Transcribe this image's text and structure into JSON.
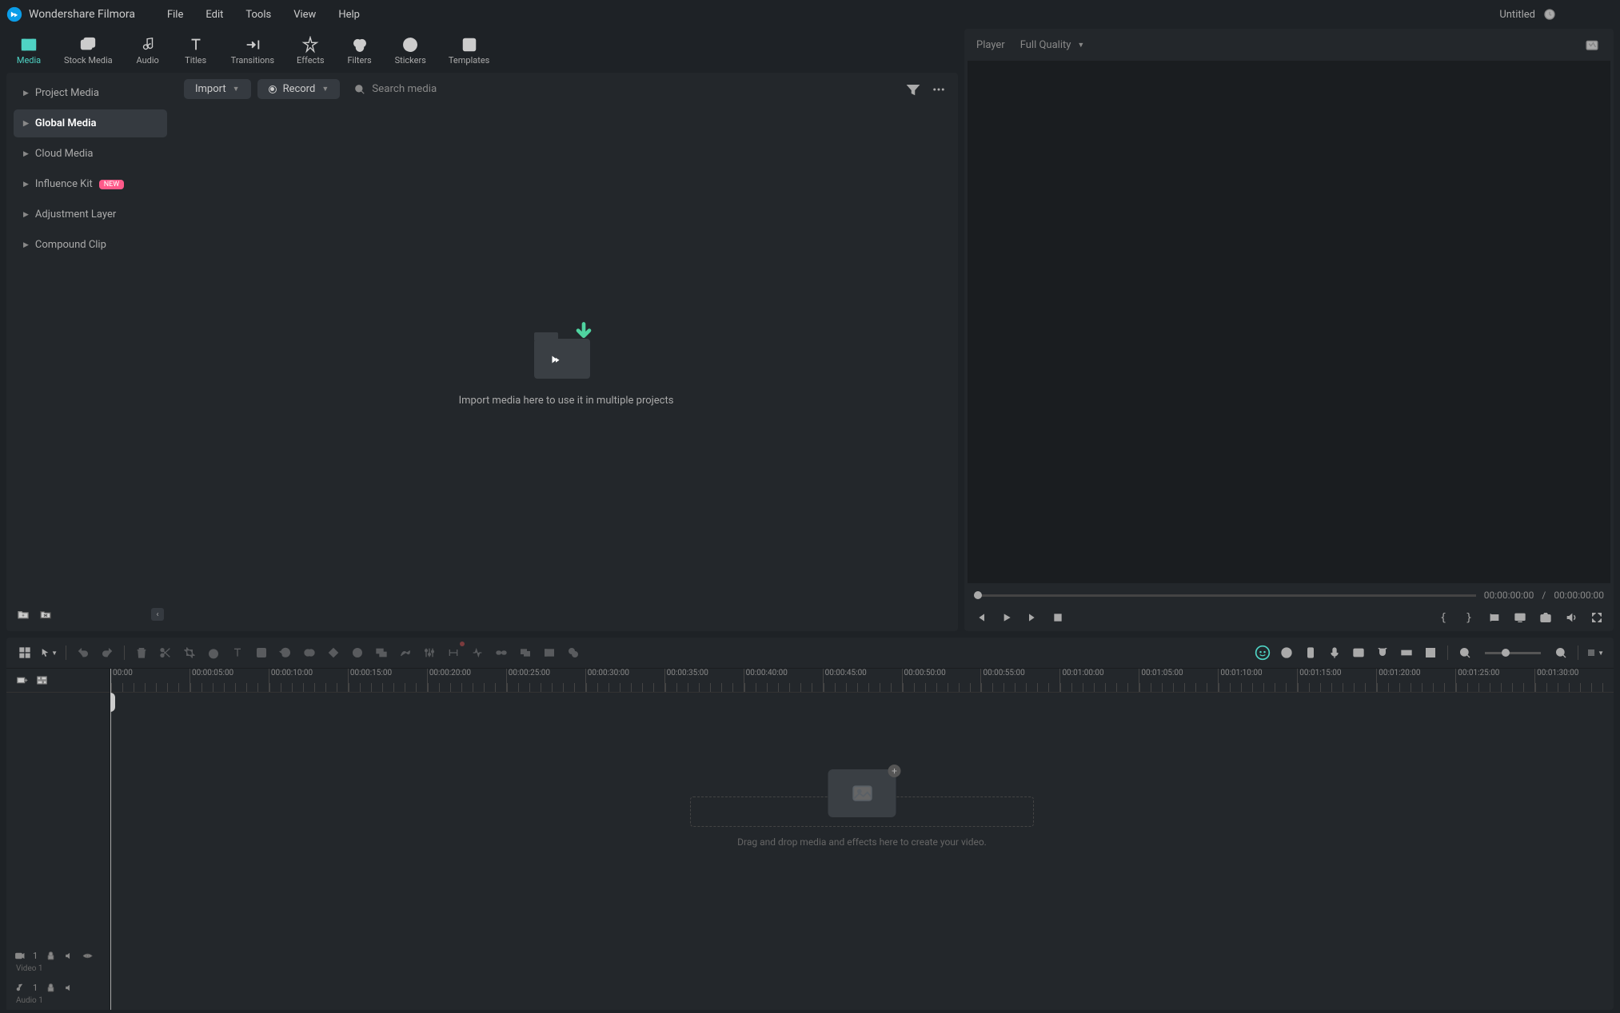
{
  "app_name": "Wondershare Filmora",
  "menu": [
    "File",
    "Edit",
    "Tools",
    "View",
    "Help"
  ],
  "project_title": "Untitled",
  "main_tabs": [
    {
      "label": "Media",
      "active": true
    },
    {
      "label": "Stock Media"
    },
    {
      "label": "Audio"
    },
    {
      "label": "Titles"
    },
    {
      "label": "Transitions"
    },
    {
      "label": "Effects"
    },
    {
      "label": "Filters"
    },
    {
      "label": "Stickers"
    },
    {
      "label": "Templates"
    }
  ],
  "sidebar": {
    "items": [
      {
        "label": "Project Media"
      },
      {
        "label": "Global Media",
        "active": true
      },
      {
        "label": "Cloud Media"
      },
      {
        "label": "Influence Kit",
        "badge": "NEW"
      },
      {
        "label": "Adjustment Layer"
      },
      {
        "label": "Compound Clip"
      }
    ]
  },
  "media_toolbar": {
    "import": "Import",
    "record": "Record",
    "search_placeholder": "Search media"
  },
  "media_empty_text": "Import media here to use it in multiple projects",
  "player": {
    "tab_label": "Player",
    "quality": "Full Quality",
    "time_current": "00:00:00:00",
    "time_total": "00:00:00:00"
  },
  "timeline": {
    "ruler": [
      "00:00",
      "00:00:05:00",
      "00:00:10:00",
      "00:00:15:00",
      "00:00:20:00",
      "00:00:25:00",
      "00:00:30:00",
      "00:00:35:00",
      "00:00:40:00",
      "00:00:45:00",
      "00:00:50:00",
      "00:00:55:00",
      "00:01:00:00",
      "00:01:05:00",
      "00:01:10:00",
      "00:01:15:00",
      "00:01:20:00",
      "00:01:25:00",
      "00:01:30:00"
    ],
    "empty_text": "Drag and drop media and effects here to create your video.",
    "tracks": {
      "video_label": "Video 1",
      "video_num": "1",
      "audio_label": "Audio 1",
      "audio_num": "1"
    }
  }
}
